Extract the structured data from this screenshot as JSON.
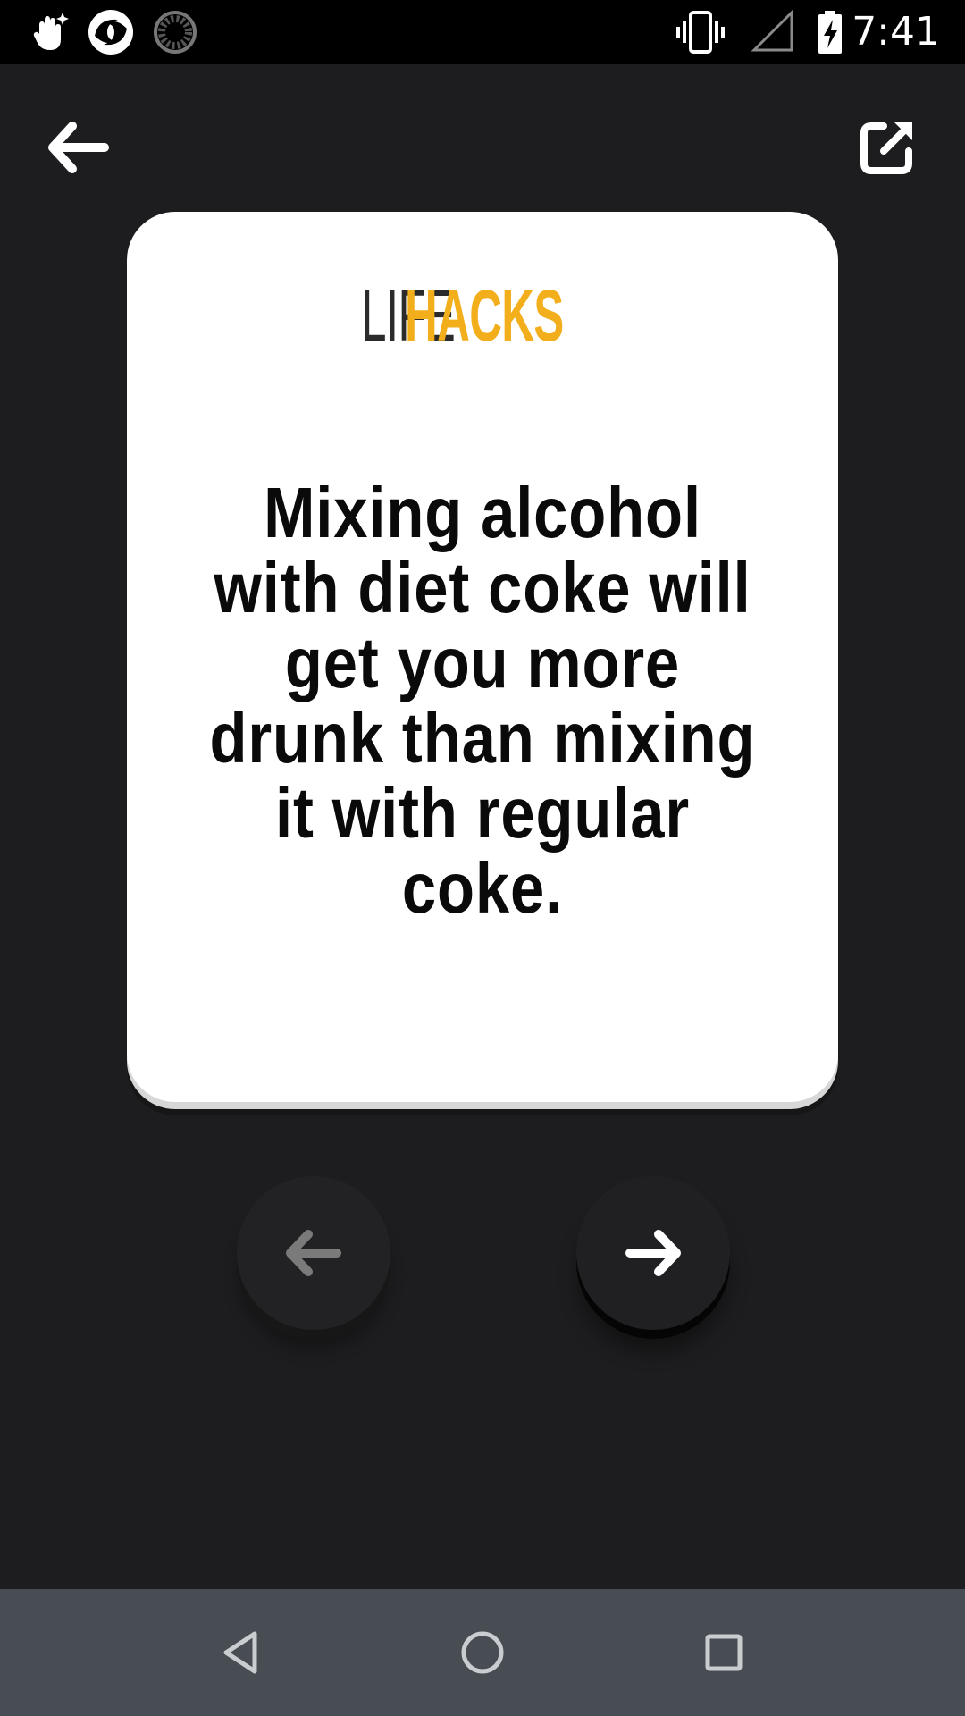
{
  "status_bar": {
    "time": "7:41",
    "left_icons": [
      "hand-sparkle-icon",
      "app-swirl-icon",
      "loading-spinner-icon"
    ],
    "right_icons": [
      "vibrate-icon",
      "signal-icon",
      "battery-charging-icon"
    ]
  },
  "toolbar": {
    "back_icon": "arrow-left-icon",
    "share_icon": "share-external-icon"
  },
  "card": {
    "logo_part1": "LIFE",
    "logo_part2": "HACKS",
    "hack_text": "Mixing alcohol with diet coke will get you more drunk than mixing it with regular coke."
  },
  "navigation": {
    "prev_icon": "arrow-left-icon",
    "next_icon": "arrow-right-icon"
  },
  "system_nav": {
    "back": "triangle-back-icon",
    "home": "circle-home-icon",
    "recents": "square-recents-icon"
  },
  "colors": {
    "background": "#1d1d1f",
    "card": "#ffffff",
    "accent": "#f2ae1b",
    "nav_bar": "#474d53",
    "prev_arrow_disabled": "#7a7a7a"
  }
}
